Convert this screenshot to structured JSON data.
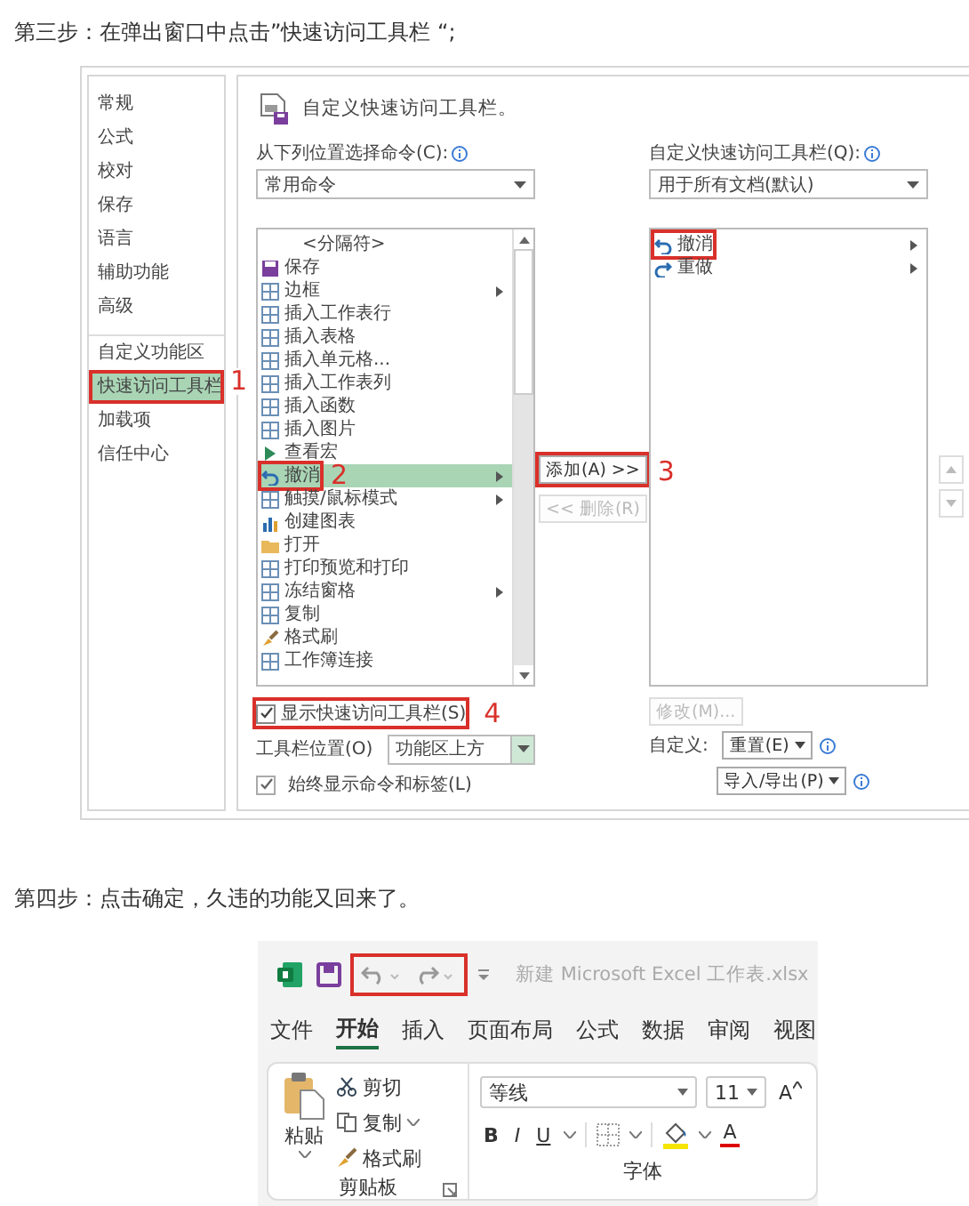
{
  "step3_text": "第三步：在弹出窗口中点击”快速访问工具栏 “;",
  "dialog": {
    "nav": [
      {
        "label": "常规",
        "selected": false,
        "boxed": false,
        "divider_before": false
      },
      {
        "label": "公式",
        "selected": false,
        "boxed": false,
        "divider_before": false
      },
      {
        "label": "校对",
        "selected": false,
        "boxed": false,
        "divider_before": false
      },
      {
        "label": "保存",
        "selected": false,
        "boxed": false,
        "divider_before": false
      },
      {
        "label": "语言",
        "selected": false,
        "boxed": false,
        "divider_before": false
      },
      {
        "label": "辅助功能",
        "selected": false,
        "boxed": false,
        "divider_before": false
      },
      {
        "label": "高级",
        "selected": false,
        "boxed": false,
        "divider_before": false
      },
      {
        "label": "自定义功能区",
        "selected": false,
        "boxed": false,
        "divider_before": true
      },
      {
        "label": "快速访问工具栏",
        "selected": true,
        "boxed": true,
        "divider_before": false,
        "annotation": "1"
      },
      {
        "label": "加载项",
        "selected": false,
        "boxed": false,
        "divider_before": false
      },
      {
        "label": "信任中心",
        "selected": false,
        "boxed": false,
        "divider_before": false
      }
    ],
    "header": "自定义快速访问工具栏。",
    "source_label": "从下列位置选择命令(C):",
    "source_select": "常用命令",
    "commands": [
      {
        "label": "<分隔符>",
        "kind": "separator",
        "submenu": false,
        "selected": false,
        "boxed": false
      },
      {
        "label": "保存",
        "kind": "save",
        "submenu": false,
        "selected": false,
        "boxed": false
      },
      {
        "label": "边框",
        "kind": "command",
        "submenu": true,
        "selected": false,
        "boxed": false
      },
      {
        "label": "插入工作表行",
        "kind": "command",
        "submenu": false,
        "selected": false,
        "boxed": false
      },
      {
        "label": "插入表格",
        "kind": "command",
        "submenu": false,
        "selected": false,
        "boxed": false
      },
      {
        "label": "插入单元格...",
        "kind": "command",
        "submenu": false,
        "selected": false,
        "boxed": false
      },
      {
        "label": "插入工作表列",
        "kind": "command",
        "submenu": false,
        "selected": false,
        "boxed": false
      },
      {
        "label": "插入函数",
        "kind": "command",
        "submenu": false,
        "selected": false,
        "boxed": false
      },
      {
        "label": "插入图片",
        "kind": "command",
        "submenu": false,
        "selected": false,
        "boxed": false
      },
      {
        "label": "查看宏",
        "kind": "play",
        "submenu": false,
        "selected": false,
        "boxed": false
      },
      {
        "label": "撤消",
        "kind": "undo",
        "submenu": true,
        "selected": true,
        "boxed": true,
        "annotation": "2"
      },
      {
        "label": "触摸/鼠标模式",
        "kind": "command",
        "submenu": true,
        "selected": false,
        "boxed": false
      },
      {
        "label": "创建图表",
        "kind": "chart",
        "submenu": false,
        "selected": false,
        "boxed": false
      },
      {
        "label": "打开",
        "kind": "folder",
        "submenu": false,
        "selected": false,
        "boxed": false
      },
      {
        "label": "打印预览和打印",
        "kind": "command",
        "submenu": false,
        "selected": false,
        "boxed": false
      },
      {
        "label": "冻结窗格",
        "kind": "command",
        "submenu": true,
        "selected": false,
        "boxed": false
      },
      {
        "label": "复制",
        "kind": "command",
        "submenu": false,
        "selected": false,
        "boxed": false
      },
      {
        "label": "格式刷",
        "kind": "brush",
        "submenu": false,
        "selected": false,
        "boxed": false
      },
      {
        "label": "工作簿连接",
        "kind": "command",
        "submenu": false,
        "selected": false,
        "boxed": false
      }
    ],
    "add_button": {
      "label": "添加(A) >>",
      "boxed": true,
      "annotation": "3"
    },
    "remove_button": {
      "label": "<< 删除(R)",
      "disabled": true
    },
    "show_toolbar": {
      "label": "显示快速访问工具栏(S)",
      "checked": true,
      "boxed": true,
      "annotation": "4"
    },
    "position_label": "工具栏位置(O)",
    "position_select": "功能区上方",
    "always_show": {
      "label": "始终显示命令和标签(L)",
      "checked": true
    },
    "target_label": "自定义快速访问工具栏(Q):",
    "target_select": "用于所有文档(默认)",
    "toolbar_commands": [
      {
        "label": "撤消",
        "kind": "undo",
        "submenu": true,
        "boxed": true
      },
      {
        "label": "重做",
        "kind": "redo",
        "submenu": true,
        "boxed": false
      }
    ],
    "modify_button": {
      "label": "修改(M)...",
      "disabled": true
    },
    "customize_label": "自定义:",
    "reset_button": "重置(E)",
    "import_export_button": "导入/导出(P)"
  },
  "step4_text": "第四步：点击确定，久违的功能又回来了。",
  "excel": {
    "title": "新建 Microsoft Excel 工作表.xlsx",
    "undo_redo_boxed": true,
    "tabs": [
      {
        "label": "文件",
        "selected": false
      },
      {
        "label": "开始",
        "selected": true
      },
      {
        "label": "插入",
        "selected": false
      },
      {
        "label": "页面布局",
        "selected": false
      },
      {
        "label": "公式",
        "selected": false
      },
      {
        "label": "数据",
        "selected": false
      },
      {
        "label": "审阅",
        "selected": false
      },
      {
        "label": "视图",
        "selected": false
      }
    ],
    "clipboard": {
      "paste": "粘贴",
      "cut": "剪切",
      "copy": "复制",
      "format_painter": "格式刷",
      "group": "剪贴板"
    },
    "font": {
      "name": "等线",
      "size": "11",
      "grow": "A",
      "style_buttons": [
        "B",
        "I",
        "U"
      ],
      "color_button": "A",
      "group": "字体"
    }
  }
}
